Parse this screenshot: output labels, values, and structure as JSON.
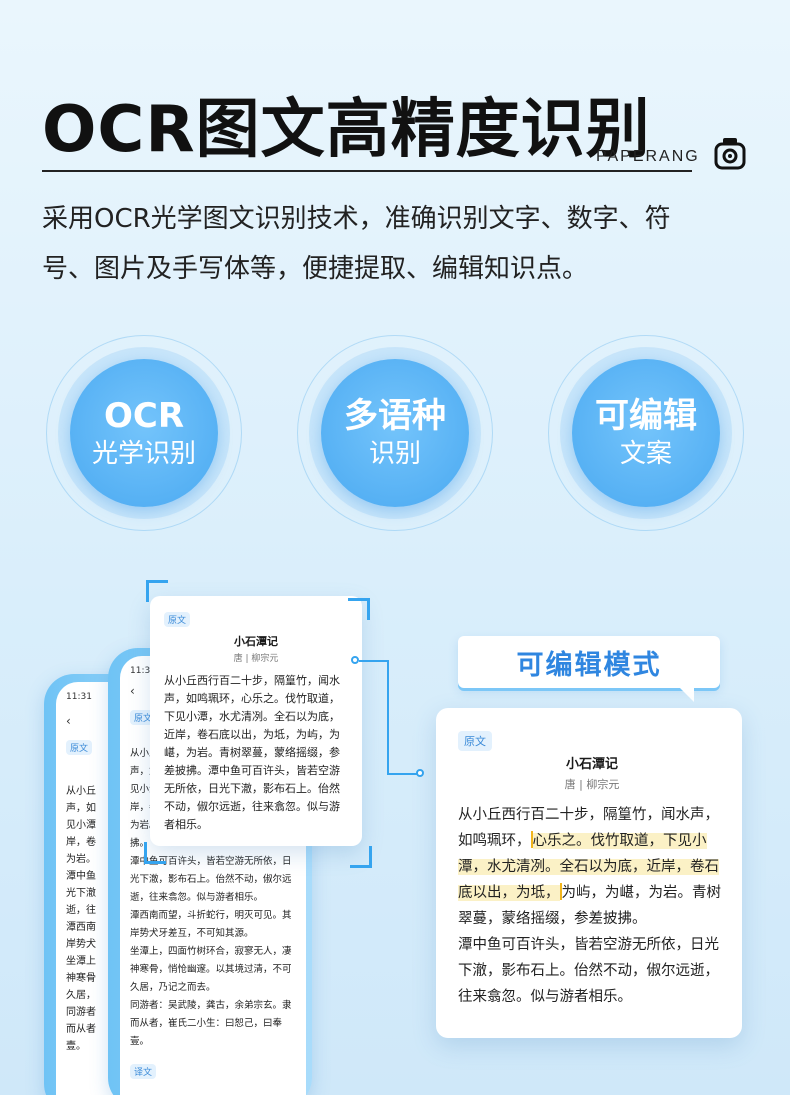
{
  "header": {
    "title": "OCR图文高精度识别",
    "brand": "PAPERANG",
    "brand_icon": "camera-logo-icon"
  },
  "subtitle": {
    "line1": "采用OCR光学图文识别技术，准确识别文字、数字、符",
    "line2": "号、图片及手写体等，便捷提取、编辑知识点。"
  },
  "features": [
    {
      "line1": "OCR",
      "line2": "光学识别"
    },
    {
      "line1": "多语种",
      "line2": "识别"
    },
    {
      "line1": "可编辑",
      "line2": "文案"
    }
  ],
  "phones": {
    "back": {
      "time": "11:31",
      "tag": "原文",
      "lines": [
        "从小丘",
        "声，如",
        "见小潭",
        "岸，卷",
        "为岩。",
        "潭中鱼",
        "光下澈",
        "逝，往",
        "潭西南",
        "岸势犬",
        "坐潭上",
        "神寒骨",
        "久居，",
        "同游者",
        "而从者",
        "壹。"
      ]
    },
    "mid": {
      "time": "11:31",
      "tag": "原文",
      "bottom_tag": "译文",
      "lines": [
        "从小丘",
        "声，如",
        "见小潭",
        "岸，卷",
        "为岩。",
        "拂。",
        "潭中鱼可百许头，皆若空游无所依，日",
        "光下澈，影布石上。佁然不动，俶尔远",
        "逝，往来翕忽。似与游者相乐。",
        "潭西南而望，斗折蛇行，明灭可见。其",
        "岸势犬牙差互，不可知其源。",
        "坐潭上，四面竹树环合，寂寥无人，凄",
        "神寒骨，悄怆幽邃。以其境过清，不可",
        "久居，乃记之而去。",
        "同游者：吴武陵，龚古，余弟宗玄。隶",
        "而从者，崔氏二小生：曰恕己，曰奉",
        "壹。"
      ]
    }
  },
  "front_card": {
    "tag": "原文",
    "title": "小石潭记",
    "author": "唐 | 柳宗元",
    "text": "从小丘西行百二十步，隔篁竹，闻水声，如鸣珮环，心乐之。伐竹取道，下见小潭，水尤清冽。全石以为底，近岸，卷石底以出，为坻，为屿，为嵁，为岩。青树翠蔓，蒙络摇缀，参差披拂。潭中鱼可百许头，皆若空游无所依，日光下澈，影布石上。佁然不动，俶尔远逝，往来翕忽。似与游者相乐。"
  },
  "mode_label": "可编辑模式",
  "right_card": {
    "tag": "原文",
    "title": "小石潭记",
    "author": "唐 | 柳宗元",
    "p1_before": "从小丘西行百二十步，隔篁竹，闻水声，如鸣珮环，",
    "p1_highlight": "心乐之。伐竹取道，下见小潭，水尤清冽。全石以为底，近岸，卷石底以出，为坻，",
    "p1_after": "为屿，为嵁，为岩。青树翠蔓，蒙络摇缀，参差披拂。",
    "p2": "潭中鱼可百许头，皆若空游无所依，日光下澈，影布石上。佁然不动，俶尔远逝，往来翕忽。似与游者相乐。"
  },
  "colors": {
    "accent": "#35a4ef",
    "circle": "#4aa9f1",
    "highlight": "#fbf1c6",
    "mode_text": "#2f86e0"
  }
}
